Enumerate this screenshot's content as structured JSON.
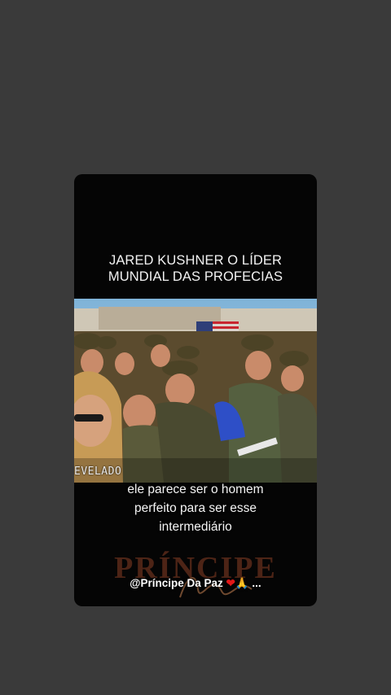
{
  "post": {
    "headline_line1": "JARED KUSHNER O LÍDER",
    "headline_line2": "MUNDIAL DAS PROFECIAS",
    "video_watermark": "EVELADO",
    "caption_line1": "ele parece ser o homem",
    "caption_line2": "perfeito para ser esse",
    "caption_line3": "intermediário",
    "brand_text": "PRÍNCIPE",
    "handle": "@Príncipe Da Paz",
    "handle_suffix": "...",
    "heart_glyph": "❤",
    "pray_glyph": "🙏"
  },
  "colors": {
    "background": "#3a3a3a",
    "card": "#050505",
    "brand": "#5a2a1a",
    "heart": "#e01818"
  }
}
